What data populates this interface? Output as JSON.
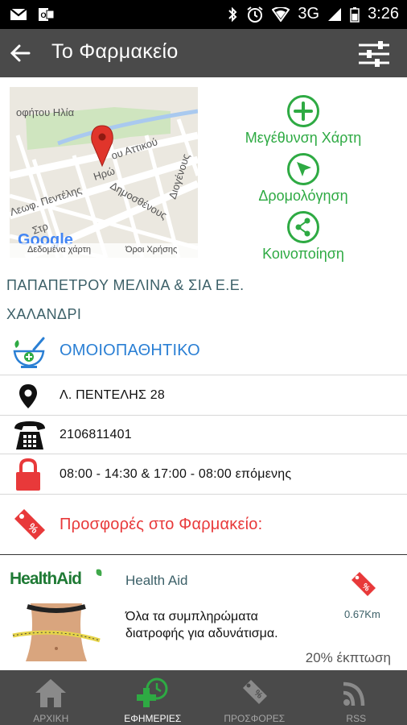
{
  "status_bar": {
    "time": "3:26",
    "network": "3G"
  },
  "app_bar": {
    "title": "Το Φαρμακείο"
  },
  "map": {
    "attribution_data": "Δεδομένα χάρτη",
    "attribution_terms": "Όροι Χρήσης",
    "logo": "Google",
    "streets": [
      "οφήτου Ηλία",
      "Ηρώ",
      "ου Αττικού",
      "Λεωφ. Πεντέλης",
      "Δημοσθένους",
      "Διογένους",
      "Στρ"
    ]
  },
  "actions": [
    {
      "label": "Μεγέθυνση Χάρτη",
      "icon": "plus-icon"
    },
    {
      "label": "Δρομολόγηση",
      "icon": "navigation-arrow-icon"
    },
    {
      "label": "Κοινοποίηση",
      "icon": "share-icon"
    }
  ],
  "pharmacy": {
    "name": "ΠΑΠΑΠΕΤΡΟΥ ΜΕΛΙΝΑ & ΣΙΑ Ε.Ε.",
    "area": "ΧΑΛΑΝΔΡΙ",
    "category": "ΟΜΟΙΟΠΑΘΗΤΙΚΟ",
    "address": "Λ. ΠΕΝΤΕΛΗΣ 28",
    "phone": "2106811401",
    "hours": "08:00 - 14:30 & 17:00 - 08:00 επόμενης",
    "offers_heading": "Προσφορές στο Φαρμακείο:"
  },
  "offer": {
    "brand": "Health Aid",
    "logo_text": "HealthAid",
    "description": "Όλα τα συμπληρώματα διατροφής για αδυνάτισμα.",
    "distance": "0.67Km",
    "discount": "20% έκπτωση"
  },
  "bottom_nav": [
    {
      "label": "ΑΡΧΙΚΗ",
      "active": false
    },
    {
      "label": "ΕΦΗΜΕΡΙΕΣ",
      "active": true
    },
    {
      "label": "ΠΡΟΣΦΟΡΕΣ",
      "active": false
    },
    {
      "label": "RSS",
      "active": false
    }
  ],
  "colors": {
    "accent_green": "#2eaa43",
    "accent_blue": "#2a7fd4",
    "accent_red": "#e8393a",
    "appbar": "#4a4a4a"
  }
}
